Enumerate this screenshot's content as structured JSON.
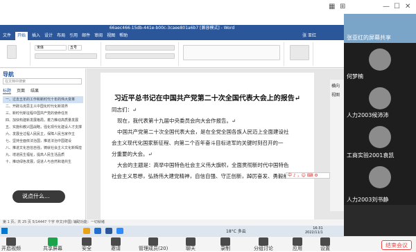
{
  "meeting": {
    "bottom_buttons": [
      {
        "label": "开启视频"
      },
      {
        "label": "共享屏幕"
      },
      {
        "label": "安全"
      },
      {
        "label": "邀请"
      },
      {
        "label": "管理成员(20)"
      },
      {
        "label": "聊天"
      },
      {
        "label": "录制"
      },
      {
        "label": "分组讨论"
      },
      {
        "label": "应用"
      },
      {
        "label": "设置"
      }
    ],
    "end_button": "结束会议"
  },
  "participants": [
    {
      "name": "张亚红的屏幕共享"
    },
    {
      "name": "何梦楠"
    },
    {
      "name": "人力2003候沛沛"
    },
    {
      "name": "工商实验2001袁凯"
    },
    {
      "name": "人力2003刘书静"
    }
  ],
  "word": {
    "title_bar": "66aec466-15db-441e-b00c-3caee801a6b7 [兼容模式] - Word",
    "user": "张 亚红",
    "ribbon_tabs": [
      "文件",
      "开始",
      "插入",
      "设计",
      "布局",
      "引用",
      "邮件",
      "审阅",
      "视图",
      "帮助"
    ],
    "active_tab": "开始",
    "font_name": "宋体",
    "font_size": "五号",
    "nav": {
      "title": "导航",
      "search_placeholder": "在文档中搜索",
      "tabs": [
        "标题",
        "页面",
        "结果"
      ],
      "items": [
        "一、过去五年的工作和新时代十年的伟大变革",
        "二、开辟马克思主义中国化时代化新境界",
        "三、新时代新征程中国共产党的使命任务",
        "四、加快构建新发展格局，着力推动高质量发展",
        "五、实施科教兴国战略，强化现代化建设人才支撑",
        "六、发展全过程人民民主，保障人民当家作主",
        "七、坚持全面依法治国，推进法治中国建设",
        "八、推进文化自信自强，铸就社会主义文化新辉煌",
        "九、增进民生福祉，提高人民生活品质",
        "十、推动绿色发展，促进人与自然和谐共生"
      ],
      "selected_index": 0
    },
    "doc": {
      "title": "习近平总书记在中国共产党第二十次全国代表大会上的报告↵",
      "lines": [
        "同志们：↵",
        "现在，我代表第十九届中央委员会向大会作报告。↵",
        "中国共产党第二十次全国代表大会，是在全党全国各族人民迈上全面建设社",
        "会主义现代化国家新征程、向第二个百年奋斗目标进军的关键时刻召开的一",
        "分重要的大会。↵",
        "大会的主题是：高举中国特色社会主义伟大旗帜，全面贯彻新时代中国特色",
        "社会主义思想，弘扬伟大建党精神，自信自强、守正创新，踔厉奋发、勇毅前行，"
      ]
    },
    "status": "第 1 页，共 25 页    5/14447 个字    中文(中国)    辅助功能：一切就绪",
    "side_labels": [
      "横向",
      "视图"
    ],
    "ime_text": "中 ♪ ，☺ ⌨ ⚙"
  },
  "chat_bubble": "说点什么...",
  "taskbar": {
    "weather": "18°C 多云",
    "time": "16:31",
    "date": "2022/11/1",
    "lang": "中"
  },
  "colors": {
    "word_blue": "#2b579a",
    "end_red": "#e44444",
    "panel_bg": "#1e1e1e"
  }
}
